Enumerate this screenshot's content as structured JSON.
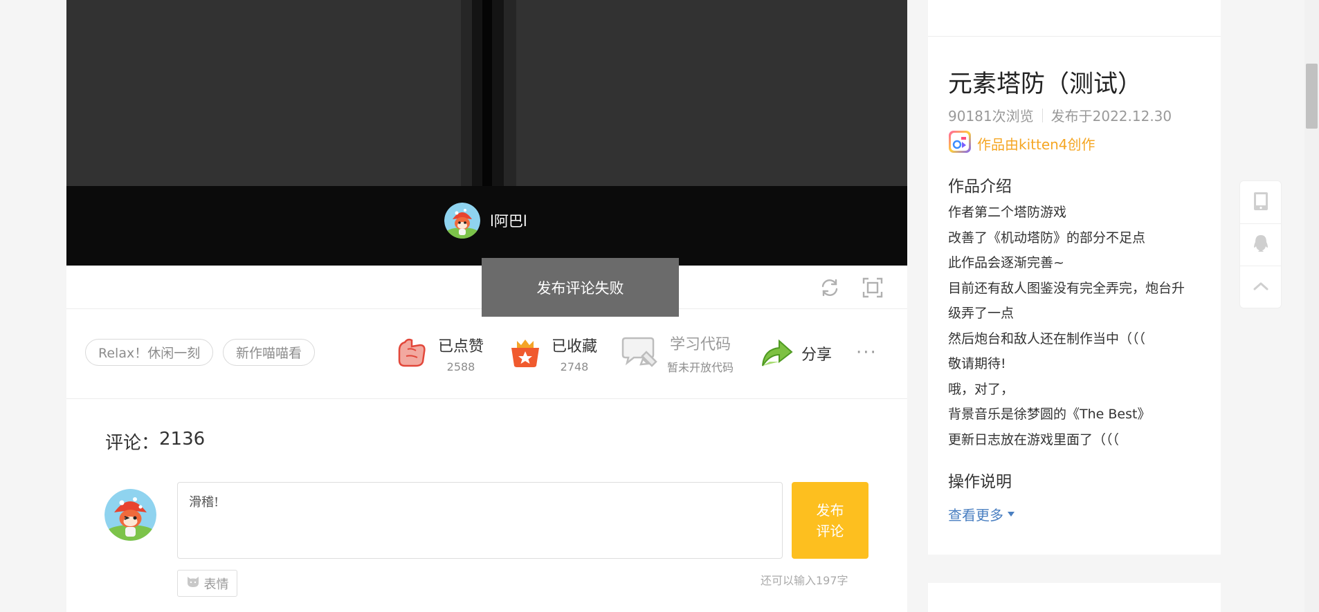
{
  "player": {
    "author_name": "l阿巴l"
  },
  "toast": {
    "message": "发布评论失败"
  },
  "tags": [
    "Relax！休闲一刻",
    "新作喵喵看"
  ],
  "actions": {
    "like": {
      "label": "已点赞",
      "count": "2588"
    },
    "collect": {
      "label": "已收藏",
      "count": "2748"
    },
    "code": {
      "label": "学习代码",
      "sub": "暂未开放代码"
    },
    "share": {
      "label": "分享"
    },
    "more": "···"
  },
  "comments": {
    "label": "评论：",
    "count": "2136",
    "input_value": "滑稽!",
    "publish_line1": "发布",
    "publish_line2": "评论",
    "emoji_label": "表情",
    "char_hint": "还可以输入197字"
  },
  "work": {
    "title": "元素塔防（测试）",
    "views": "90181次浏览",
    "published": "发布于2022.12.30",
    "creator": "作品由kitten4创作",
    "intro_heading": "作品介绍",
    "intro_lines": [
      "作者第二个塔防游戏",
      "改善了《机动塔防》的部分不足点",
      "此作品会逐渐完善~",
      "目前还有敌人图鉴没有完全弄完，炮台升",
      "级弄了一点",
      "然后炮台和敌人还在制作当中（（（",
      "敬请期待!",
      "哦，对了，",
      "背景音乐是徐梦圆的《The Best》",
      "更新日志放在游戏里面了（（（"
    ],
    "controls_heading": "操作说明",
    "see_more": "查看更多"
  },
  "colors": {
    "accent": "#fdbf1f",
    "link": "#4a7fc1",
    "creator": "#f5a623",
    "toast_bg": "#6b6b6b"
  },
  "icons": [
    "refresh-icon",
    "fullscreen-icon",
    "thumbs-up-icon",
    "collect-box-icon",
    "code-icon",
    "share-arrow-icon",
    "cat-emoji-icon",
    "kitten4-logo-icon",
    "mobile-icon",
    "qq-icon",
    "back-to-top-icon"
  ]
}
